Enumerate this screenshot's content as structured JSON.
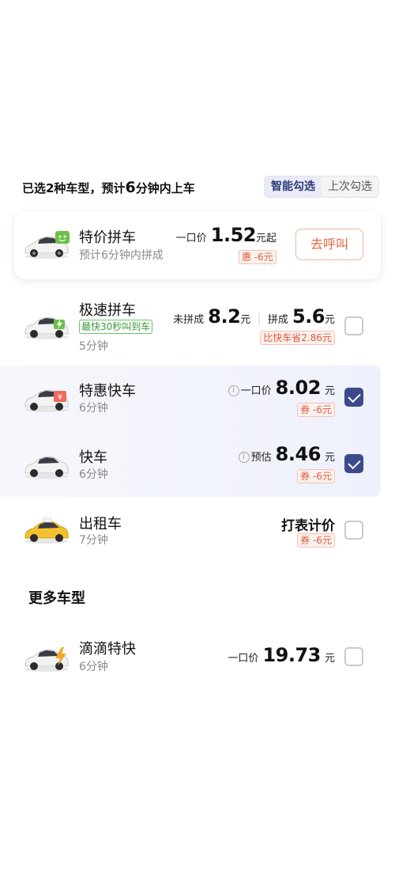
{
  "header": {
    "title_pre": "已选2种车型，预计",
    "title_num": "6",
    "title_post": "分钟内上车",
    "tab_smart": "智能勾选",
    "tab_last": "上次勾选"
  },
  "featured": {
    "name": "特价拼车",
    "sub": "预计6分钟内拼成",
    "price_prefix": "一口价",
    "price": "1.52",
    "price_suffix": "元起",
    "coupon": "惠 -6元",
    "button": "去呼叫"
  },
  "rides": [
    {
      "name": "极速拼车",
      "tag": "最快30秒叫到车",
      "eta": "5分钟",
      "label_a": "未拼成",
      "price_a": "8.2",
      "unit_a": "元",
      "label_b": "拼成",
      "price_b": "5.6",
      "unit_b": "元",
      "note": "比快车省2.86元",
      "checked": false
    },
    {
      "name": "特惠快车",
      "eta": "6分钟",
      "price_prefix": "一口价",
      "price": "8.02",
      "unit": "元",
      "coupon": "券 -6元",
      "checked": true
    },
    {
      "name": "快车",
      "eta": "6分钟",
      "price_prefix": "预估",
      "price": "8.46",
      "unit": "元",
      "coupon": "券 -6元",
      "checked": true
    },
    {
      "name": "出租车",
      "eta": "7分钟",
      "price_text": "打表计价",
      "coupon": "券 -6元",
      "checked": false
    }
  ],
  "more_section": {
    "title": "更多车型",
    "items": [
      {
        "name": "滴滴特快",
        "eta": "6分钟",
        "price_prefix": "一口价",
        "price": "19.73",
        "unit": "元",
        "checked": false
      }
    ]
  },
  "colors": {
    "accent": "#3b4a8c",
    "coupon": "#e05a3c",
    "green": "#3a9a3a",
    "taxi": "#f2c12e"
  },
  "icons": [
    "car-pool-icon",
    "car-express-pool-icon",
    "car-discount-icon",
    "car-icon",
    "taxi-icon",
    "car-premium-icon",
    "info-icon",
    "checkbox-checked-icon"
  ]
}
